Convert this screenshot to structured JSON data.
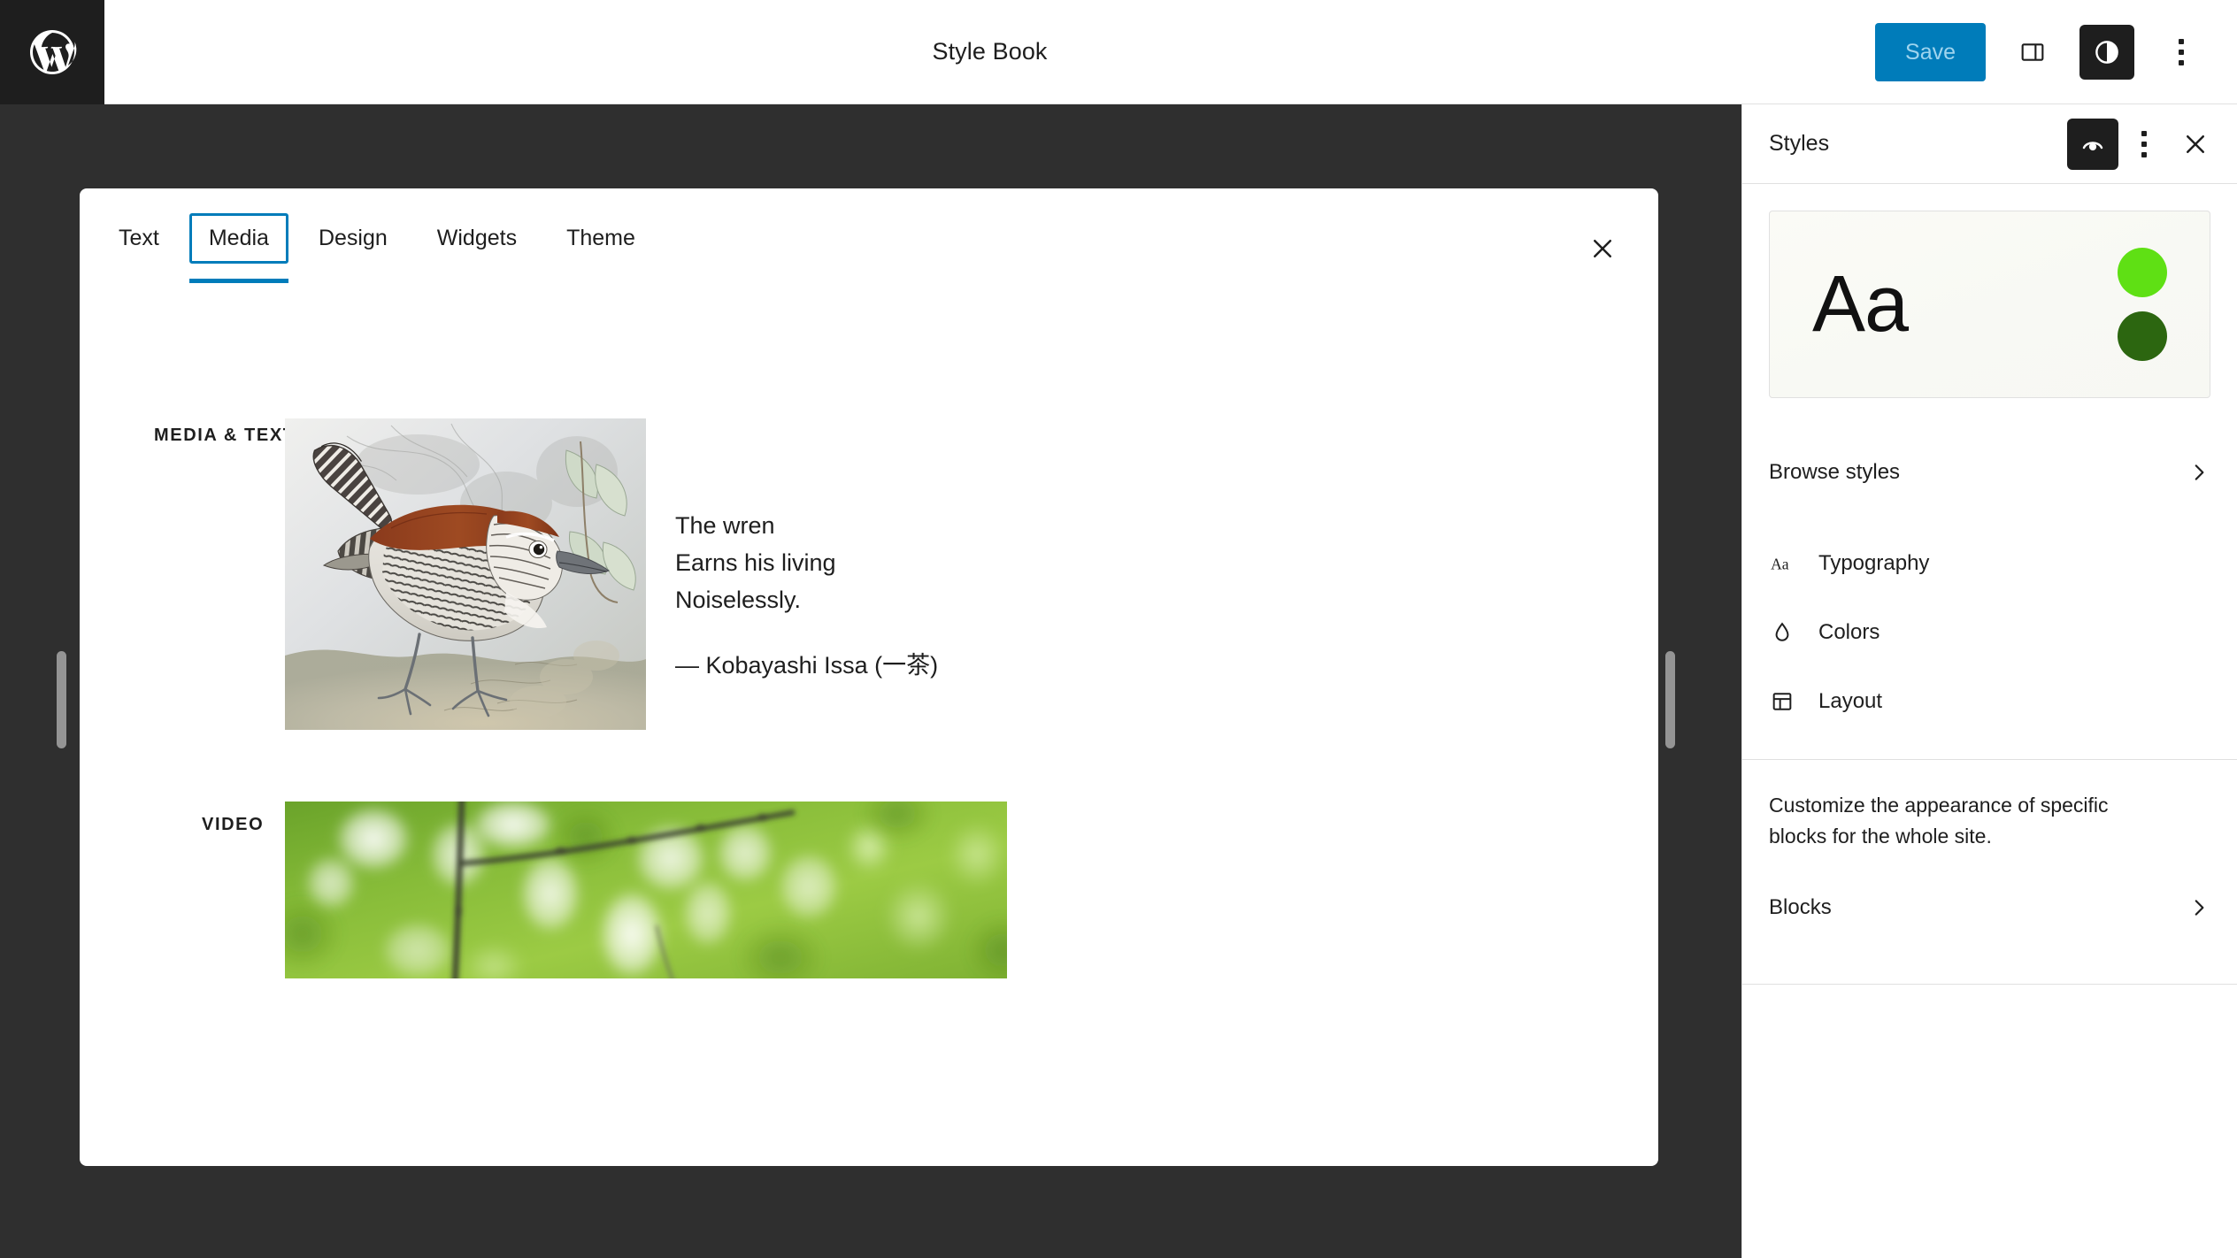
{
  "header": {
    "logo_icon": "wordpress-logo-icon",
    "title": "Style Book",
    "save_label": "Save",
    "sidebar_toggle_icon": "sidebar-panel-icon",
    "styles_icon": "contrast-styles-icon",
    "options_icon": "kebab-menu-icon"
  },
  "stylebook": {
    "tabs": [
      {
        "label": "Text",
        "selected": false
      },
      {
        "label": "Media",
        "selected": true
      },
      {
        "label": "Design",
        "selected": false
      },
      {
        "label": "Widgets",
        "selected": false
      },
      {
        "label": "Theme",
        "selected": false
      }
    ],
    "close_icon": "close-icon",
    "sections": [
      {
        "label": "MEDIA & TEXT",
        "type": "media-text",
        "image_alt": "Illustration of a banded wren perched on the ground",
        "text_lines": [
          "The wren",
          "Earns his living",
          "Noiselessly."
        ],
        "attribution": "— Kobayashi Issa (一茶)"
      },
      {
        "label": "VIDEO",
        "type": "video",
        "poster_alt": "Green leaves bokeh with thin branches"
      }
    ]
  },
  "sidebar": {
    "title": "Styles",
    "style_book_icon": "style-book-eye-icon",
    "options_icon": "kebab-menu-icon",
    "close_icon": "close-icon",
    "preview": {
      "sample_text": "Aa",
      "colors": [
        "#5fe014",
        "#2c6610"
      ]
    },
    "browse_styles": {
      "label": "Browse styles",
      "chevron_icon": "chevron-right-icon"
    },
    "items": [
      {
        "label": "Typography",
        "icon": "typography-aa-icon"
      },
      {
        "label": "Colors",
        "icon": "color-drop-icon"
      },
      {
        "label": "Layout",
        "icon": "layout-grid-icon"
      }
    ],
    "blocks_description": "Customize the appearance of specific blocks for the whole site.",
    "blocks": {
      "label": "Blocks",
      "chevron_icon": "chevron-right-icon"
    }
  },
  "theme": {
    "accent": "#007cba",
    "dark_bg": "#2f2f2f",
    "panel_bg": "#ffffff",
    "text": "#1e1e1e"
  }
}
